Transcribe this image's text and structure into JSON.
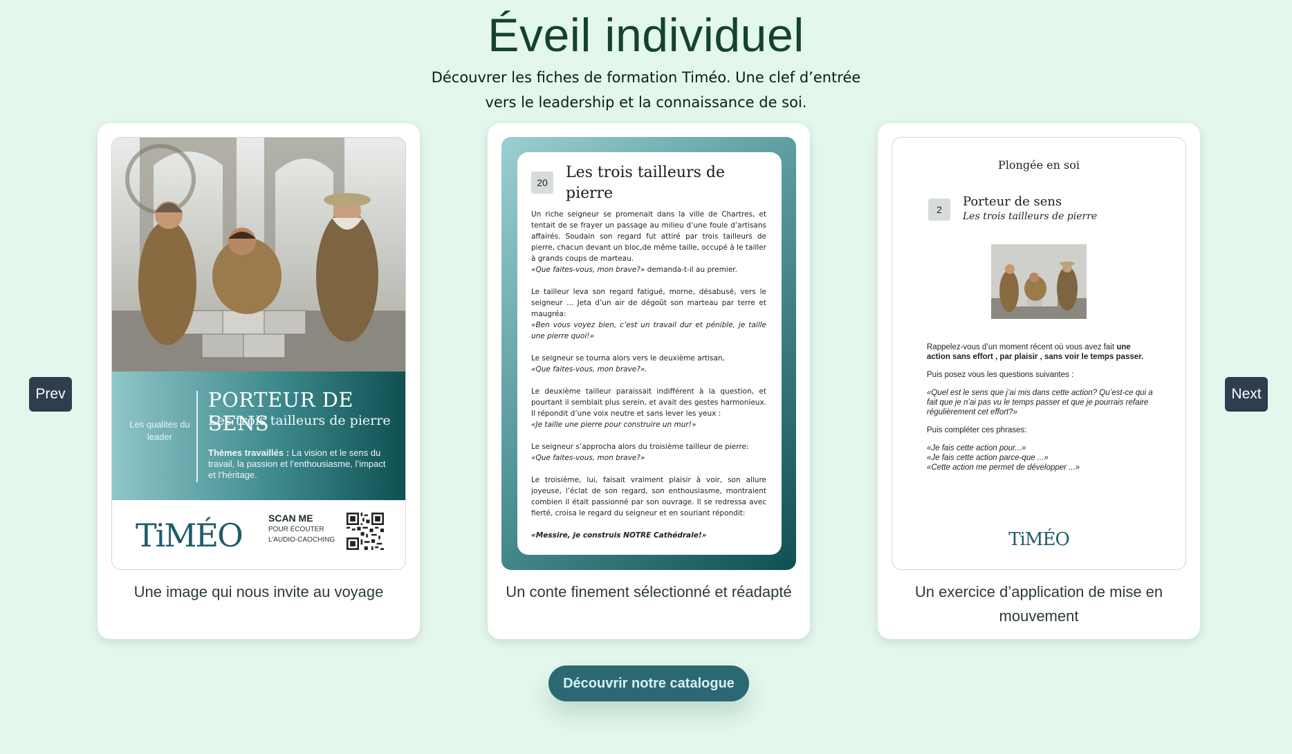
{
  "header": {
    "title": "Éveil individuel",
    "subtitle": "Découvrer les fiches de formation Timéo. Une clef d’entrée vers le leadership et la connaissance de soi."
  },
  "nav": {
    "prev_label": "Prev",
    "next_label": "Next"
  },
  "cards": [
    {
      "caption": "Une image qui nous invite au voyage",
      "band": {
        "qualities": "Les qualités du leader",
        "heading": "PORTEUR DE SENS",
        "subheading": "Les trois tailleurs de pierre",
        "themes_label": "Thèmes travaillés :",
        "themes_text": " La vision et le sens du travail, la passion et l’enthousiasme, l’impact et l’héritage."
      },
      "footer": {
        "logo": "TiMÉO",
        "scan_title": "SCAN ME",
        "scan_line1": "POUR ÉCOUTER",
        "scan_line2": "L’AUDIO-CAOCHING"
      }
    },
    {
      "caption": "Un conte finement sélectionné et réadapté",
      "number": "20",
      "title": "Les trois tailleurs de pierre",
      "story": {
        "p1": "Un riche seigneur se promenait dans la ville de Chartres, et tentait de se frayer un passage au milieu d’une foule d’artisans affairés. Soudain son regard fut attiré par trois tailleurs de pierre, chacun devant un bloc,de même taille, occupé à le tailler à grands coups de marteau.",
        "p1_quote": "«Que faites-vous, mon brave?»",
        "p1_after": " demanda-t-il au premier.",
        "p2": "Le tailleur leva son regard fatigué, morne, désabusé, vers le seigneur ... Jeta d’un air de dégoût son marteau par terre et maugréa:",
        "p2_quote": "«Ben vous voyez bien, c’est un travail dur et pénible, je taille une pierre quoi!»",
        "p3": "Le seigneur se tourna alors vers le deuxième artisan,",
        "p3_quote": "«Que faites-vous, mon brave?».",
        "p4": "Le deuxième tailleur paraissait indifférent à la question, et pourtant il semblait plus serein, et avait des gestes harmonieux. Il répondit d’une voix neutre et sans lever les yeux :",
        "p4_quote": "«Je taille une pierre pour construire un mur!»",
        "p5": "Le seigneur s’approcha alors du troisième tailleur de pierre:",
        "p5_quote": "«Que faites-vous, mon brave?»",
        "p6": "Le troisième, lui, faisait vraiment plaisir à voir, son allure joyeuse, l’éclat de son regard, son enthousiasme, montraient combien il était passionné par son ouvrage. Il se redressa avec fierté, croisa le regard du seigneur et en souriant répondit:",
        "p7": "«Messire, je construis NOTRE Cathédrale!»"
      }
    },
    {
      "caption": "Un exercice d’application de mise en mouvement",
      "section": "Plongée en soi",
      "number": "2",
      "title": "Porteur de sens",
      "subtitle": "Les trois tailleurs de pierre",
      "ex": {
        "intro": "Rappelez-vous d’un moment récent où vous avez fait ",
        "intro_bold": "une action sans effort , par plaisir , sans voir le temps passer.",
        "q_intro": "Puis posez vous les questions suivantes :",
        "question": "«Quel est le sens que j’ai mis dans cette action? Qu’est-ce qui a fait que je n’ai pas vu le temps passer et que je pourrais refaire régulièrement cet effort?»",
        "c_intro": "Puis compléter ces phrases:",
        "s1": "«Je fais cette action pour...»",
        "s2": "«Je fais cette action parce-que ...»",
        "s3": "«Cette action me permet de développer ...»"
      },
      "logo": "TiMÉO"
    }
  ],
  "cta_label": "Découvrir notre catalogue",
  "colors": {
    "background": "#e3f7ec",
    "title": "#14422f",
    "teal_dark": "#0f5052",
    "teal_light": "#9ccfd0",
    "button": "#2b6873",
    "nav_button": "#2f3d4e"
  }
}
